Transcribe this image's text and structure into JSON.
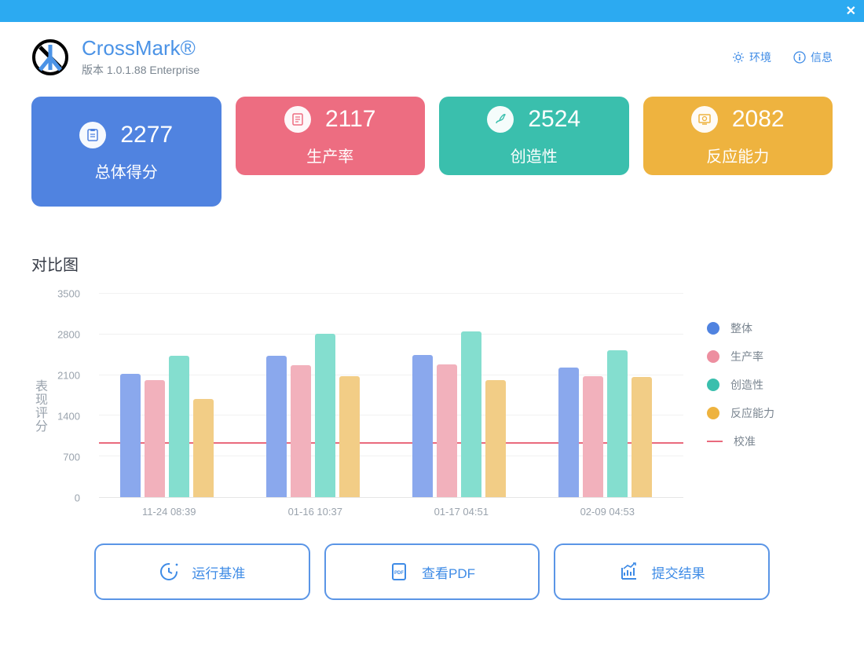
{
  "app": {
    "title": "CrossMark®",
    "version": "版本 1.0.1.88 Enterprise"
  },
  "header_links": {
    "env": "环境",
    "info": "信息"
  },
  "cards": {
    "overall": {
      "value": "2277",
      "label": "总体得分"
    },
    "productivity": {
      "value": "2117",
      "label": "生产率"
    },
    "creativity": {
      "value": "2524",
      "label": "创造性"
    },
    "responsiveness": {
      "value": "2082",
      "label": "反应能力"
    }
  },
  "section_title": "对比图",
  "chart_data": {
    "type": "bar",
    "ylabel": "表现评分",
    "ylim": [
      0,
      3500
    ],
    "yticks": [
      3500,
      2800,
      2100,
      1400,
      700,
      0
    ],
    "categories": [
      "11-24 08:39",
      "01-16 10:37",
      "01-17 04:51",
      "02-09 04:53"
    ],
    "series": [
      {
        "name": "整体",
        "key": "overall",
        "values": [
          2120,
          2420,
          2440,
          2220
        ]
      },
      {
        "name": "生产率",
        "key": "productivity",
        "values": [
          2000,
          2260,
          2280,
          2080
        ]
      },
      {
        "name": "创造性",
        "key": "creativity",
        "values": [
          2420,
          2800,
          2840,
          2520
        ]
      },
      {
        "name": "反应能力",
        "key": "responsiveness",
        "values": [
          1680,
          2080,
          2000,
          2060
        ]
      }
    ],
    "calibration": {
      "name": "校准",
      "value": 920
    }
  },
  "legend": {
    "overall": "整体",
    "productivity": "生产率",
    "creativity": "创造性",
    "responsiveness": "反应能力",
    "calibration": "校准"
  },
  "buttons": {
    "run": "运行基准",
    "pdf": "查看PDF",
    "submit": "提交结果"
  },
  "colors": {
    "blue": "#5083e0",
    "red": "#ed6d81",
    "teal": "#3abfad",
    "yellow": "#eeb33f"
  }
}
